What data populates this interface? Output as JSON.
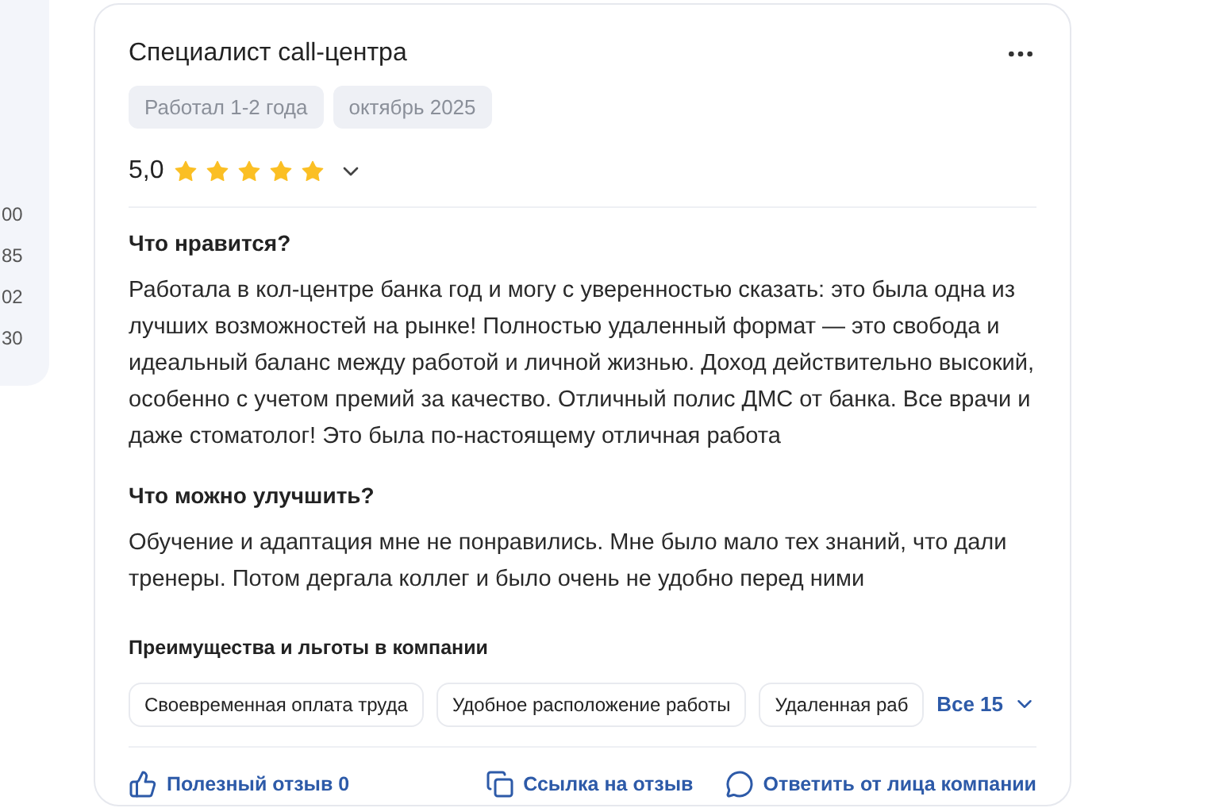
{
  "left_panel": {
    "values": [
      "00",
      "85",
      "02",
      "30"
    ]
  },
  "review": {
    "title": "Специалист call-центра",
    "tags": [
      "Работал 1-2 года",
      "октябрь 2025"
    ],
    "rating": "5,0",
    "stars": 5,
    "sections": [
      {
        "heading": "Что нравится?",
        "text": "Работала в кол-центре банка год и могу с уверенностью сказать: это была одна из лучших возможностей на рынке! Полностью удаленный формат — это свобода и идеальный баланс между работой и личной жизнью. Доход действительно высокий, особенно с учетом премий за качество. Отличный полис ДМС от банка. Все врачи и даже стоматолог! Это была по-настоящему отличная работа"
      },
      {
        "heading": "Что можно улучшить?",
        "text": "Обучение и адаптация мне не понравились. Мне было мало тех знаний, что дали тренеры. Потом дергала коллег и было очень не удобно перед ними"
      }
    ],
    "benefits": {
      "heading": "Преимущества и льготы в компании",
      "items": [
        "Своевременная оплата труда",
        "Удобное расположение работы",
        "Удаленная раб"
      ],
      "more": "Все 15"
    },
    "actions": [
      {
        "kind": "like",
        "label": "Полезный отзыв 0"
      },
      {
        "kind": "link",
        "label": "Ссылка на отзыв"
      },
      {
        "kind": "reply",
        "label": "Ответить от лица компании"
      }
    ]
  }
}
